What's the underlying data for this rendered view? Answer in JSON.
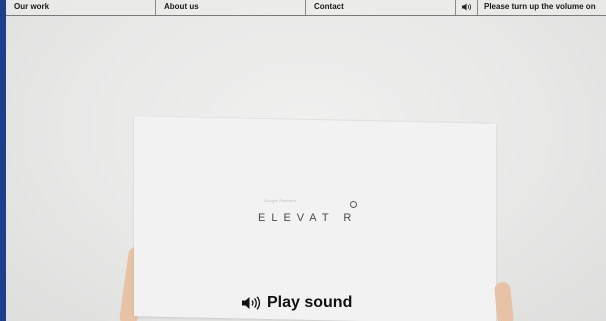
{
  "nav": {
    "items": [
      {
        "label": "Our work"
      },
      {
        "label": "About us"
      },
      {
        "label": "Contact"
      }
    ],
    "volume_icon": "speaker-icon",
    "message": "Please turn up the volume on"
  },
  "product": {
    "brand_small": "Google Partners",
    "brand": "ELEVAT R"
  },
  "play": {
    "icon": "speaker-sound-icon",
    "label": "Play sound"
  },
  "colors": {
    "border": "#1d3f8e",
    "background": "#ebebea",
    "text": "#111111"
  }
}
